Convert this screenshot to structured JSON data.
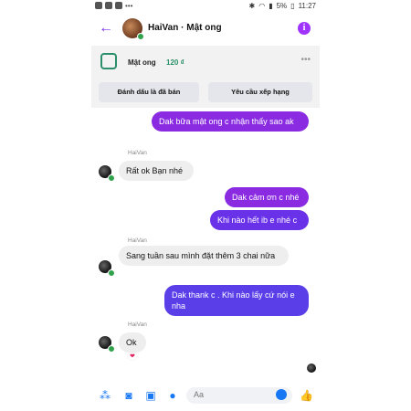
{
  "status": {
    "battery": "5%",
    "time": "11:27"
  },
  "header": {
    "title": "HaiVan · Mật ong"
  },
  "product": {
    "name": "Mật ong",
    "price": "120 ₫"
  },
  "actions": {
    "mark_sold": "Đánh dấu là đã bán",
    "request_review": "Yêu cầu xếp hạng"
  },
  "messages": [
    {
      "text": "Dak bữa mật ong c nhận thấy sao ak"
    },
    {
      "sender": "HaiVan",
      "text": "Rất ok Bạn nhé"
    },
    {
      "text": "Dak cảm ơn c nhé"
    },
    {
      "text": "Khi nào hết ib e nhé c"
    },
    {
      "sender": "HaiVan",
      "text": "Sang tuần  sau mình đặt thêm 3 chai nữa"
    },
    {
      "text": "Dak thank c . Khi nào lấy cứ nói e nha"
    },
    {
      "sender": "HaiVan",
      "text": "Ok"
    }
  ],
  "composer": {
    "placeholder": "Aa"
  }
}
